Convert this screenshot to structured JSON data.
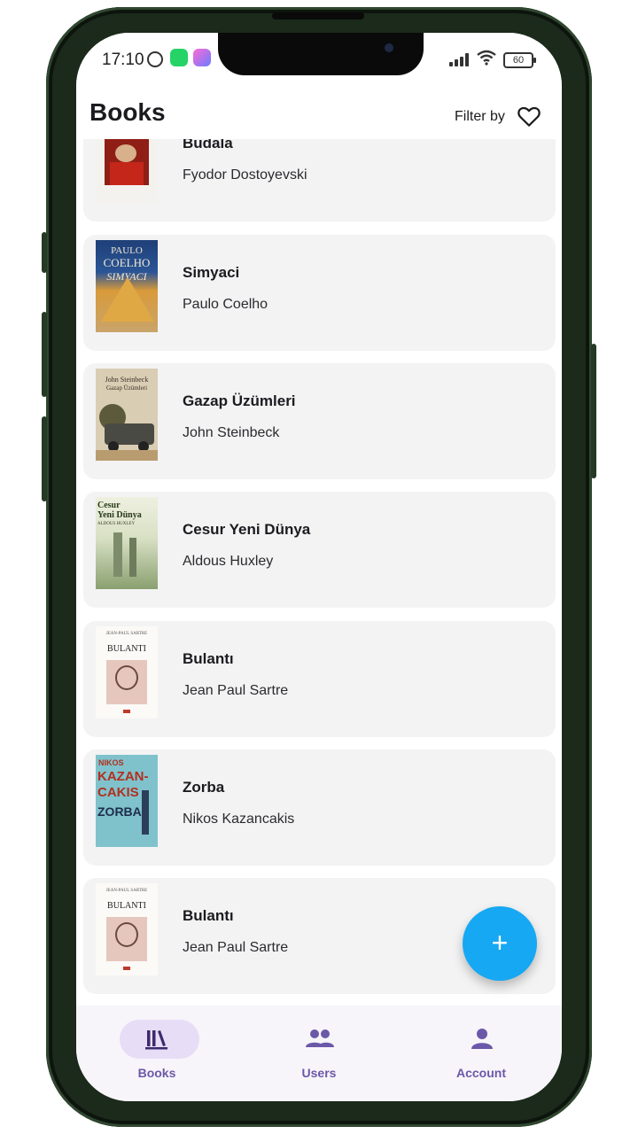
{
  "status": {
    "time": "17:10",
    "battery": "60"
  },
  "appbar": {
    "title": "Books",
    "filter_label": "Filter by"
  },
  "books": [
    {
      "title": "Budala",
      "author": "Fyodor Dostoyevski"
    },
    {
      "title": "Simyaci",
      "author": "Paulo Coelho"
    },
    {
      "title": "Gazap Üzümleri",
      "author": "John Steinbeck"
    },
    {
      "title": "Cesur Yeni Dünya",
      "author": "Aldous Huxley"
    },
    {
      "title": "Bulantı",
      "author": "Jean Paul Sartre"
    },
    {
      "title": "Zorba",
      "author": "Nikos Kazancakis"
    },
    {
      "title": "Bulantı",
      "author": "Jean Paul Sartre"
    }
  ],
  "covers": {
    "simyaci": {
      "line1": "PAULO",
      "line2": "COELHO",
      "line3": "SIMYACI"
    },
    "gazap": {
      "line1": "John Steinbeck",
      "line2": "Gazap Üzümleri"
    },
    "cesur": {
      "line1": "Cesur",
      "line2": "Yeni Dünya",
      "line3": "ALDOUS HUXLEY"
    },
    "bulanti": {
      "line1": "JEAN-PAUL SARTRE",
      "line2": "BULANTI"
    },
    "zorba": {
      "line1": "NIKOS",
      "line2": "KAZAN-",
      "line3": "CAKIS",
      "line4": "ZORBA"
    }
  },
  "fab": {
    "label": "+"
  },
  "nav": [
    {
      "label": "Books",
      "icon": "library-icon"
    },
    {
      "label": "Users",
      "icon": "users-icon"
    },
    {
      "label": "Account",
      "icon": "person-icon"
    }
  ],
  "colors": {
    "accent": "#16a8f2",
    "nav_active": "#e7ddf6",
    "nav_label": "#6c58a8",
    "card_bg": "#f3f3f4"
  }
}
